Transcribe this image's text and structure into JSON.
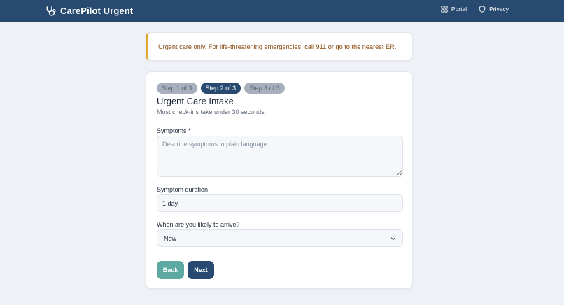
{
  "header": {
    "brand": "CarePilot Urgent",
    "nav": [
      {
        "label": "Portal",
        "icon": "grid-icon"
      },
      {
        "label": "Privacy",
        "icon": "shield-icon"
      }
    ]
  },
  "alert": {
    "text": "Urgent care only. For life-threatening emergencies, call 911 or go to the nearest ER."
  },
  "form": {
    "steps": [
      "Step 1 of 3",
      "Step 2 of 3",
      "Step 3 of 3"
    ],
    "active_step": 2,
    "title": "Urgent Care Intake",
    "subtitle": "Most check-ins take under 30 seconds.",
    "symptoms": {
      "label": "Symptoms *",
      "value": "",
      "placeholder": "Describe symptoms in plain language..."
    },
    "duration": {
      "label": "Symptom duration",
      "value": "1 day"
    },
    "arrival": {
      "label": "When are you likely to arrive?",
      "selected": "Now"
    },
    "buttons": {
      "back": "Back",
      "next": "Next"
    }
  },
  "colors": {
    "header": "#284a70",
    "alert_border": "#e0a72e",
    "alert_text": "#8a4a12",
    "back_button": "#5ea9a2",
    "next_button": "#284a70"
  }
}
